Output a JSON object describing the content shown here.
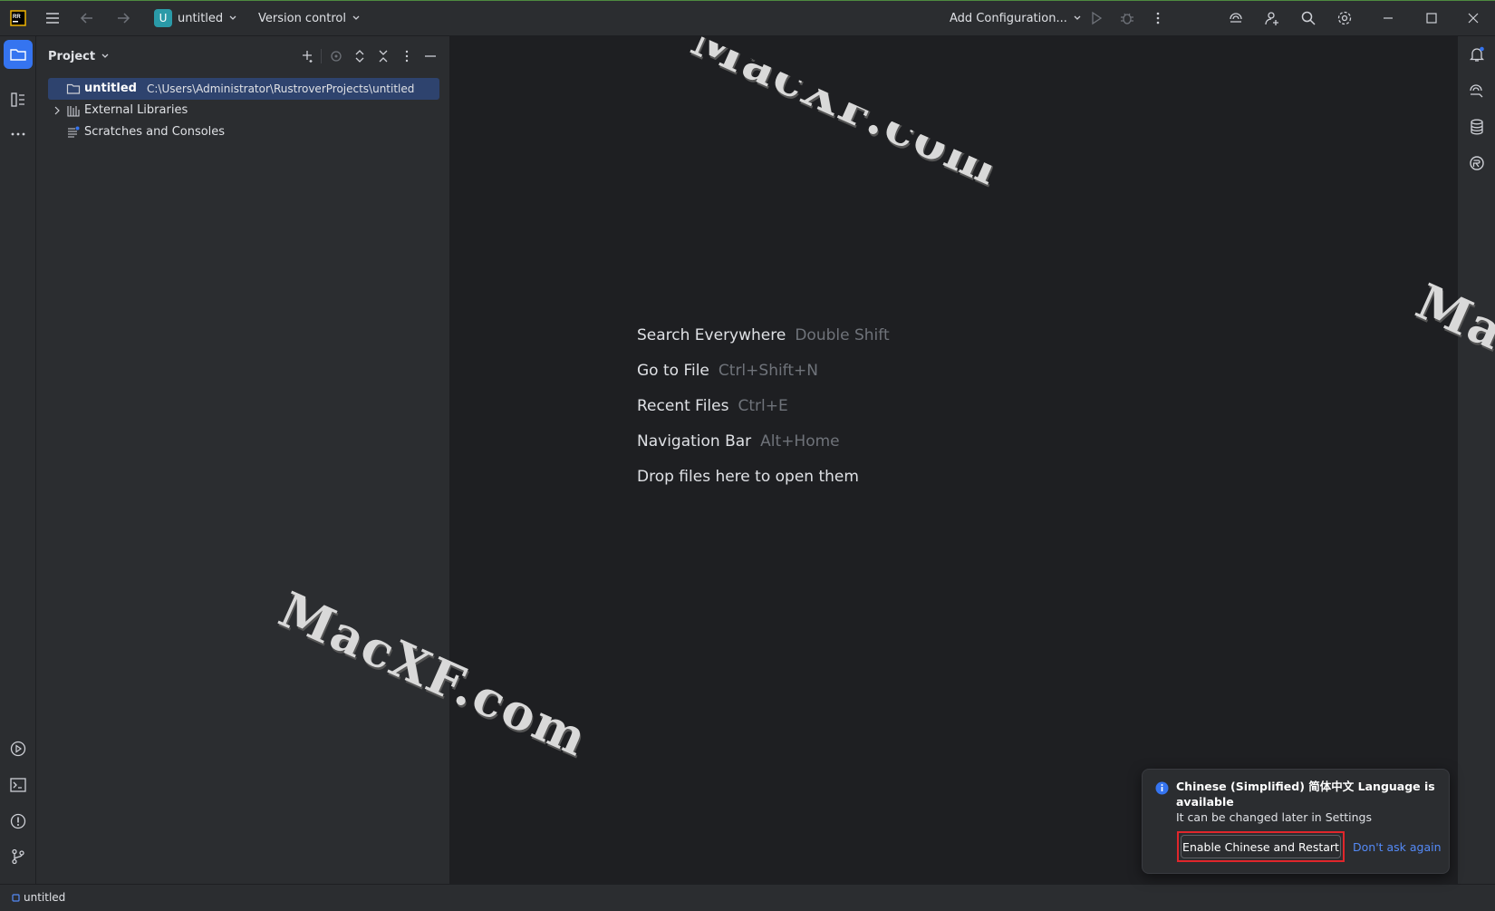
{
  "titlebar": {
    "project_badge": "U",
    "project_name": "untitled",
    "version_control": "Version control",
    "run_config": "Add Configuration..."
  },
  "project_panel": {
    "title": "Project",
    "tree": [
      {
        "name": "untitled",
        "path": "C:\\Users\\Administrator\\RustroverProjects\\untitled",
        "selected": true
      },
      {
        "name": "External Libraries",
        "path": "",
        "selected": false
      },
      {
        "name": "Scratches and Consoles",
        "path": "",
        "selected": false
      }
    ]
  },
  "editor": {
    "hints": [
      {
        "label": "Search Everywhere",
        "shortcut": "Double Shift"
      },
      {
        "label": "Go to File",
        "shortcut": "Ctrl+Shift+N"
      },
      {
        "label": "Recent Files",
        "shortcut": "Ctrl+E"
      },
      {
        "label": "Navigation Bar",
        "shortcut": "Alt+Home"
      },
      {
        "label": "Drop files here to open them",
        "shortcut": ""
      }
    ]
  },
  "notification": {
    "title": "Chinese (Simplified) 简体中文 Language is available",
    "body": "It can be changed later in Settings",
    "primary_action": "Enable Chinese and Restart",
    "secondary_action": "Don't ask again"
  },
  "statusbar": {
    "project": "untitled"
  },
  "watermark": {
    "text": "MacXF.com"
  },
  "colors": {
    "accent": "#3574f0",
    "selection": "#2e436e",
    "badge": "#2a9aa8",
    "link": "#548af7",
    "highlight_border": "#e0262b"
  },
  "icons": [
    "app-logo-icon",
    "main-menu-icon",
    "back-arrow-icon",
    "forward-arrow-icon",
    "chevron-down-icon",
    "run-icon",
    "debug-icon",
    "more-vertical-icon",
    "ai-assistant-icon",
    "add-user-icon",
    "search-icon",
    "gear-icon",
    "minimize-icon",
    "maximize-icon",
    "close-icon",
    "folder-icon",
    "structure-icon",
    "more-horizontal-icon",
    "run-tool-icon",
    "terminal-icon",
    "problems-icon",
    "git-icon",
    "bell-icon",
    "chat-icon",
    "database-icon",
    "rust-icon",
    "plus-icon",
    "locate-icon",
    "expand-all-icon",
    "collapse-all-icon",
    "hide-icon",
    "chevron-right-icon",
    "library-icon",
    "scratches-icon",
    "info-icon"
  ]
}
